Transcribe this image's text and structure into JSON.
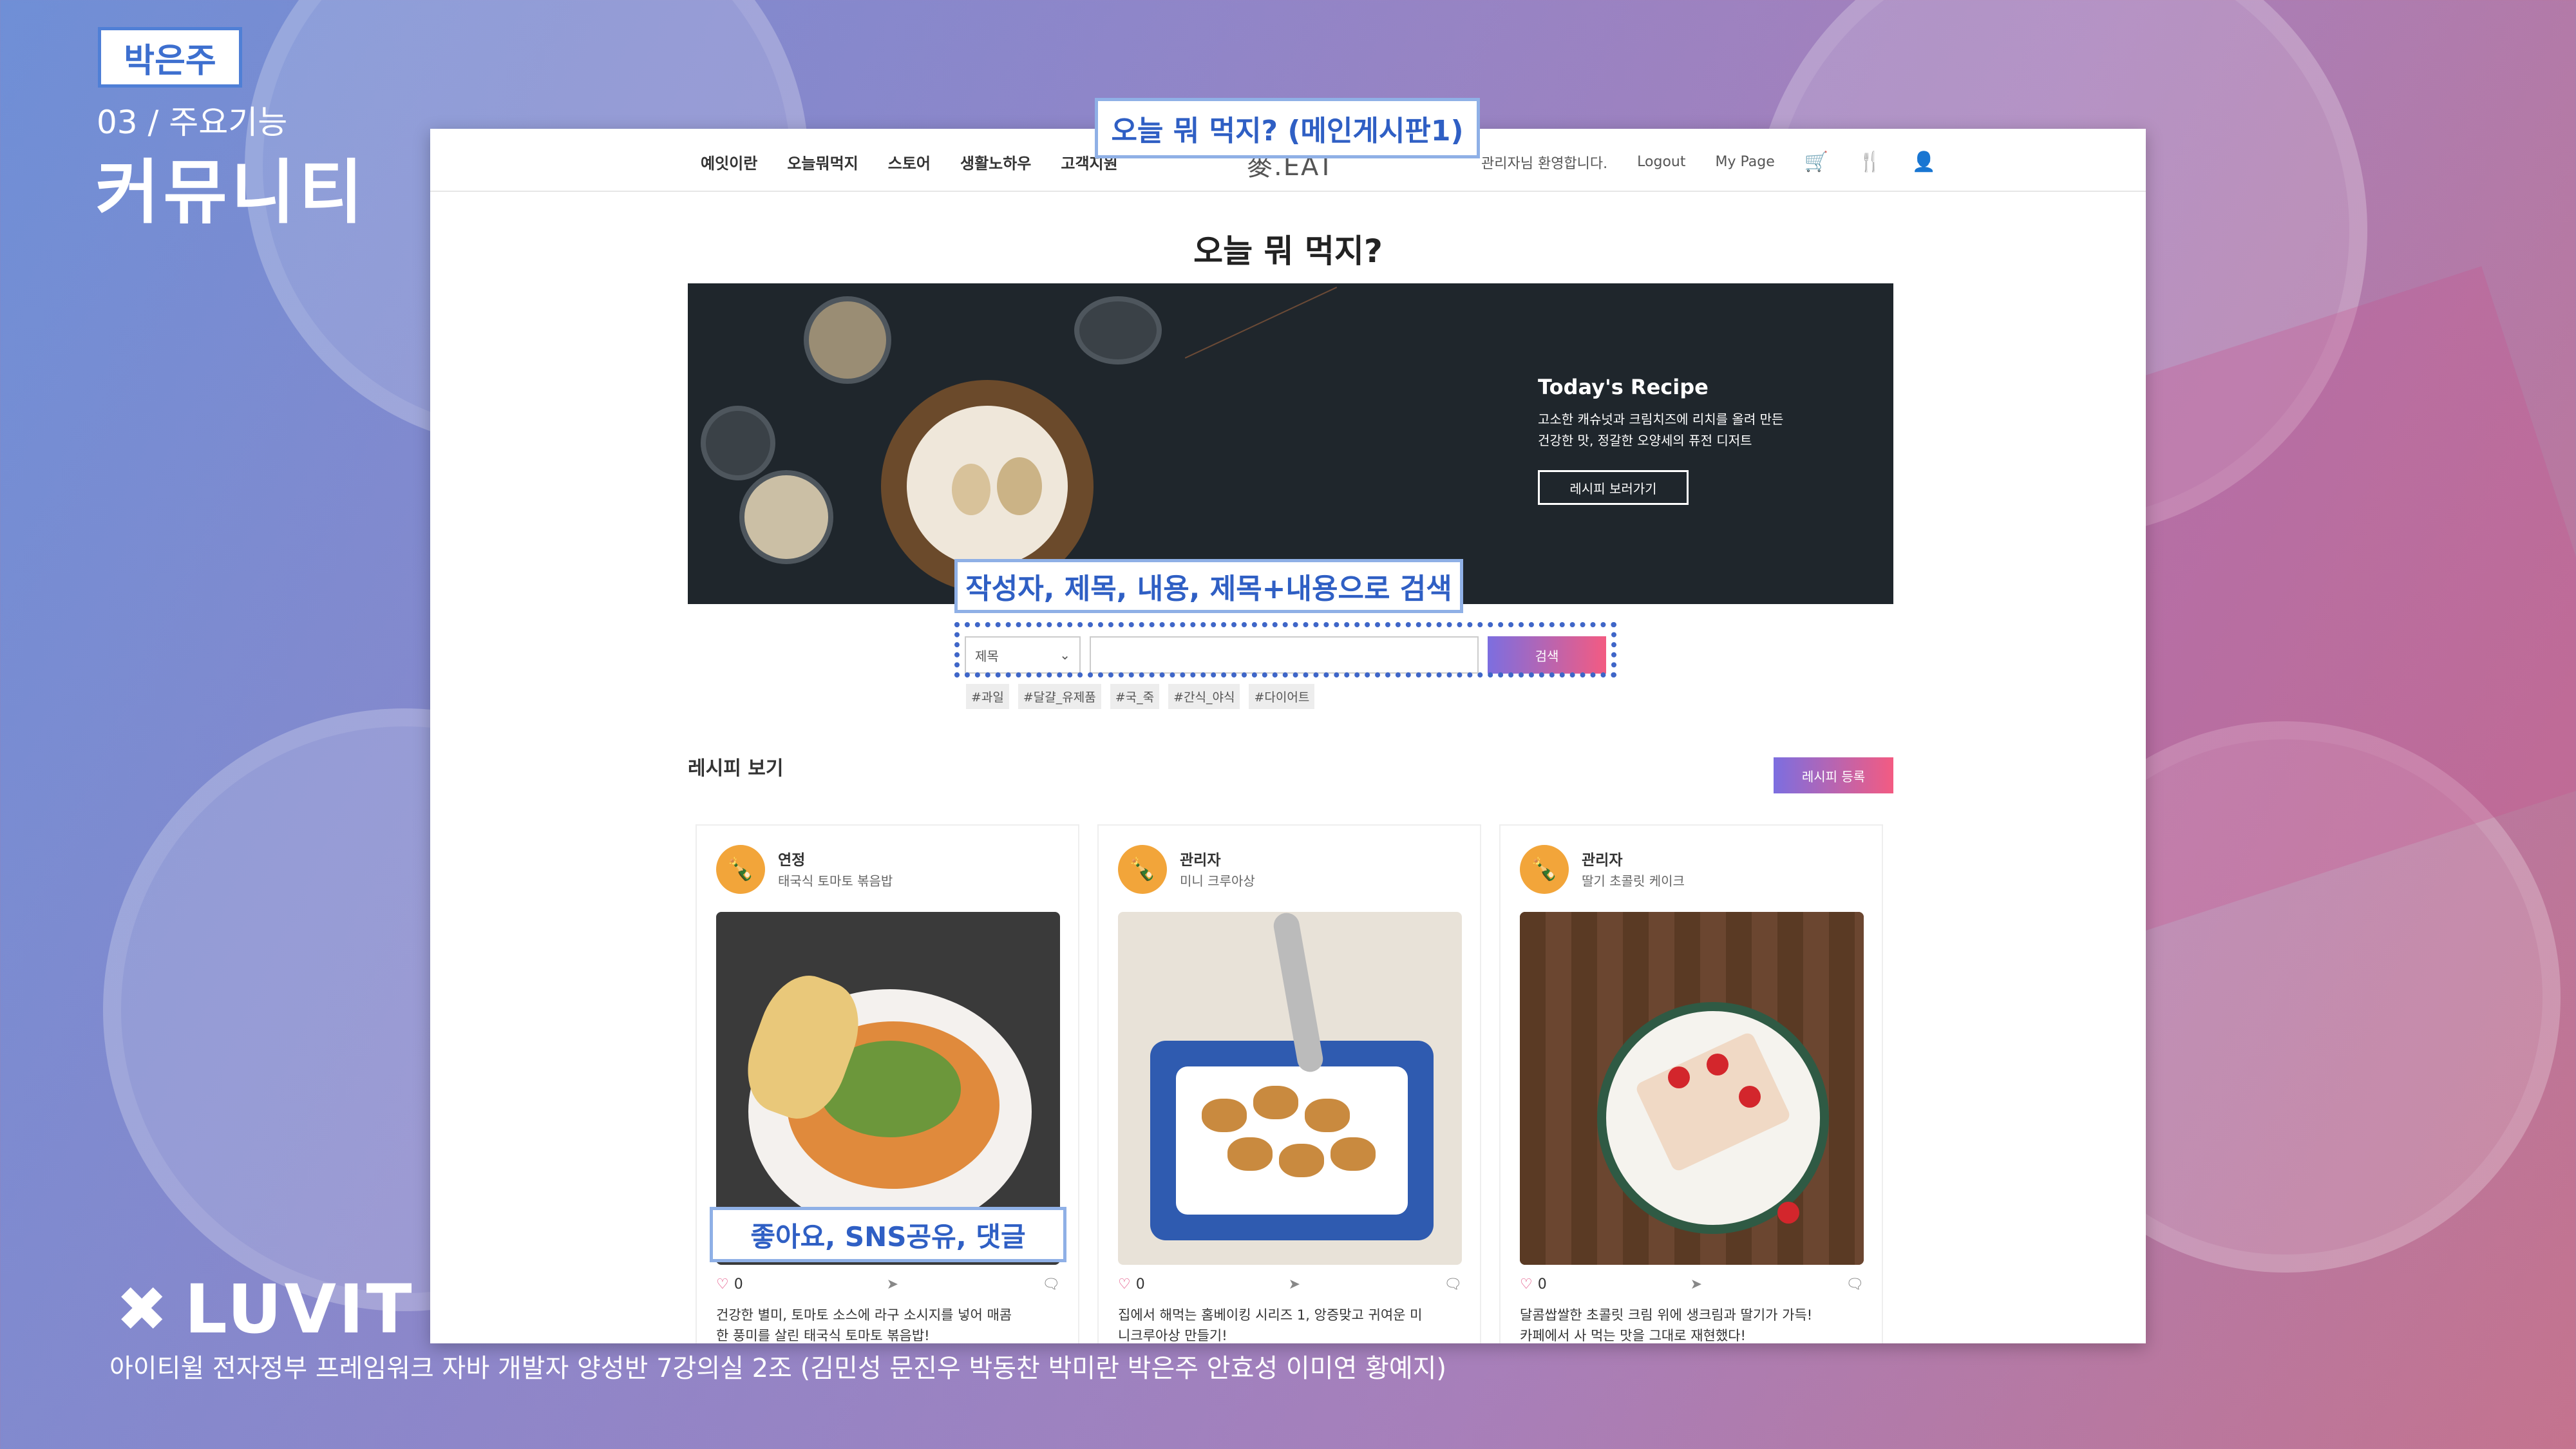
{
  "slide": {
    "author": "박은주",
    "section_label": "03 / 주요기능",
    "section_title": "커뮤니티",
    "logo_text": "LUVIT",
    "footer_credit": "아이티윌 전자정부 프레임워크 자바 개발자 양성반 7강의실 2조 (김민성 문진우 박동찬 박미란 박은주 안효성 이미연 황예지)"
  },
  "callouts": {
    "top": "오늘 뭐 먹지? (메인게시판1)",
    "search": "작성자, 제목, 내용, 제목+내용으로 검색",
    "like": "좋아요, SNS공유, 댓글"
  },
  "site": {
    "brand": "麥.EAT",
    "nav": [
      "예잇이란",
      "오늘뭐먹지",
      "스토어",
      "생활노하우",
      "고객지원"
    ],
    "greeting": "관리자님 환영합니다.",
    "logout": "Logout",
    "mypage": "My Page",
    "icons": [
      "cart-icon",
      "fork-knife-icon",
      "user-settings-icon"
    ]
  },
  "page": {
    "title": "오늘 뭐 먹지?",
    "banner": {
      "title": "Today's Recipe",
      "desc_line1": "고소한 캐슈넛과 크림치즈에 리치를 올려 만든",
      "desc_line2": "건강한 맛, 정갈한 오양세의 퓨전 디저트",
      "button": "레시피 보러가기"
    },
    "search": {
      "select_value": "제목",
      "input_value": "",
      "button": "검색",
      "hashtags": [
        "#과일",
        "#달걀_유제품",
        "#국_죽",
        "#간식_야식",
        "#다이어트"
      ]
    },
    "section_title": "레시피 보기",
    "register_button": "레시피 등록"
  },
  "cards": [
    {
      "author": "연정",
      "title": "태국식 토마토 볶음밥",
      "likes": "0",
      "desc_line1": "건강한 별미, 토마토 소스에 라구 소시지를 넣어 매콤",
      "desc_line2": "한 풍미를 살린 태국식 토마토 볶음밥!"
    },
    {
      "author": "관리자",
      "title": "미니 크루아상",
      "likes": "0",
      "desc_line1": "집에서 해먹는 홈베이킹 시리즈 1, 앙증맞고 귀여운 미",
      "desc_line2": "니크루아상 만들기!"
    },
    {
      "author": "관리자",
      "title": "딸기 초콜릿 케이크",
      "likes": "0",
      "desc_line1": "달콤쌉쌀한 초콜릿 크림 위에 생크림과 딸기가 가득!",
      "desc_line2": "카페에서 사 먹는 맛을 그대로 재현했다!"
    }
  ],
  "colors": {
    "accent_blue": "#3d6fcf",
    "gradient_start": "#7c6ee0",
    "gradient_end": "#f35b82",
    "like_color": "#e0457b"
  }
}
